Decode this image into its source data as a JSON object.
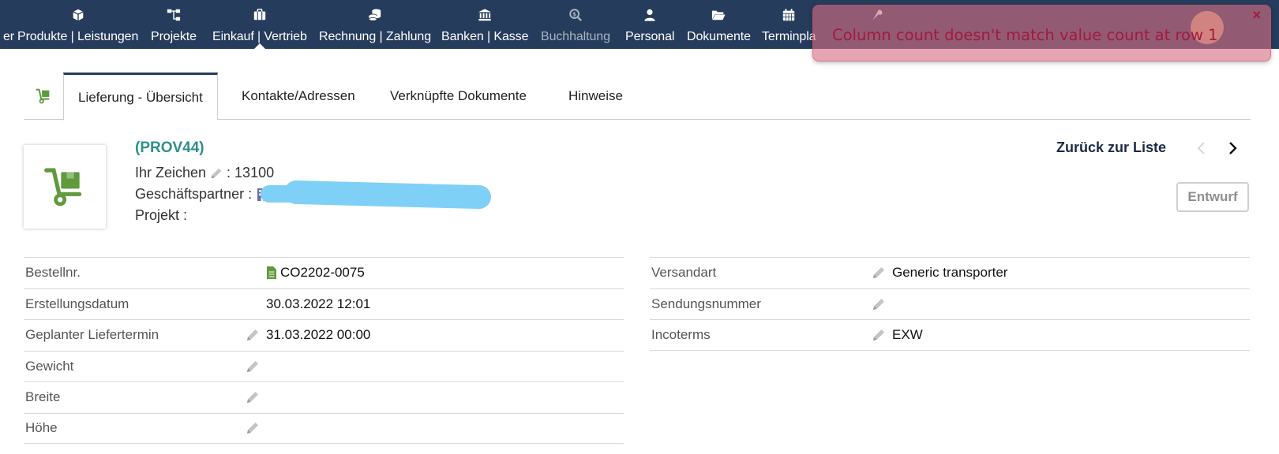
{
  "nav": {
    "items": [
      {
        "label": "er",
        "icon": "partial-icon"
      },
      {
        "label": "Produkte | Leistungen",
        "icon": "box-icon"
      },
      {
        "label": "Projekte",
        "icon": "sitemap-icon"
      },
      {
        "label": "Einkauf | Vertrieb",
        "icon": "briefcase-icon"
      },
      {
        "label": "Rechnung | Zahlung",
        "icon": "coins-icon"
      },
      {
        "label": "Banken | Kasse",
        "icon": "bank-icon"
      },
      {
        "label": "Buchhaltung",
        "icon": "search-dollar-icon"
      },
      {
        "label": "Personal",
        "icon": "user-icon"
      },
      {
        "label": "Dokumente",
        "icon": "folder-icon"
      },
      {
        "label": "Terminpla",
        "icon": "calendar-icon"
      }
    ]
  },
  "toast": {
    "message": "Column count doesn't match value count at row 1",
    "close": "×"
  },
  "tabs": [
    {
      "label": "Lieferung - Übersicht"
    },
    {
      "label": "Kontakte/Adressen"
    },
    {
      "label": "Verknüpfte Dokumente"
    },
    {
      "label": "Hinweise"
    }
  ],
  "header": {
    "ref": "(PROV44)",
    "ihr_zeichen_label": "Ihr Zeichen",
    "ihr_zeichen_value": ": 13100",
    "partner_label": "Geschäftspartner :",
    "projekt_label": "Projekt :",
    "back_link": "Zurück zur Liste",
    "status": "Entwurf"
  },
  "left_fields": [
    {
      "label": "Bestellnr.",
      "value": "CO2202-0075",
      "editable": false,
      "doc_icon": true
    },
    {
      "label": "Erstellungsdatum",
      "value": "30.03.2022 12:01",
      "editable": false
    },
    {
      "label": "Geplanter Liefertermin",
      "value": "31.03.2022 00:00",
      "editable": true
    },
    {
      "label": "Gewicht",
      "value": "",
      "editable": true
    },
    {
      "label": "Breite",
      "value": "",
      "editable": true
    },
    {
      "label": "Höhe",
      "value": "",
      "editable": true
    }
  ],
  "right_fields": [
    {
      "label": "Versandart",
      "value": "Generic transporter",
      "editable": true
    },
    {
      "label": "Sendungsnummer",
      "value": "",
      "editable": true
    },
    {
      "label": "Incoterms",
      "value": "EXW",
      "editable": true
    }
  ],
  "colors": {
    "nav_bg": "#263c5c",
    "accent_teal": "#2f8f8c",
    "icon_green": "#5f9a3c",
    "error_text": "#a21a3c"
  }
}
